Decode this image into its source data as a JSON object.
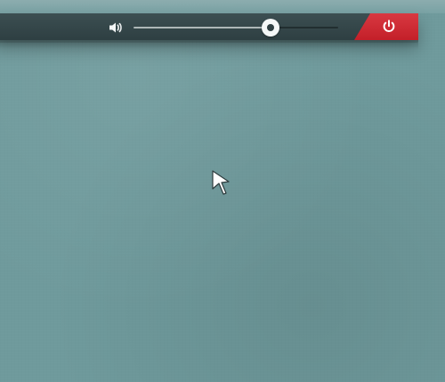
{
  "topbar": {
    "volume": {
      "icon": "speaker-volume-icon",
      "level": 0.67
    },
    "power": {
      "icon": "power-icon",
      "accent_color": "#d4222c"
    }
  },
  "desktop": {
    "background_color": "#6f9a9c",
    "pointer_icon": "mouse-pointer-icon"
  }
}
